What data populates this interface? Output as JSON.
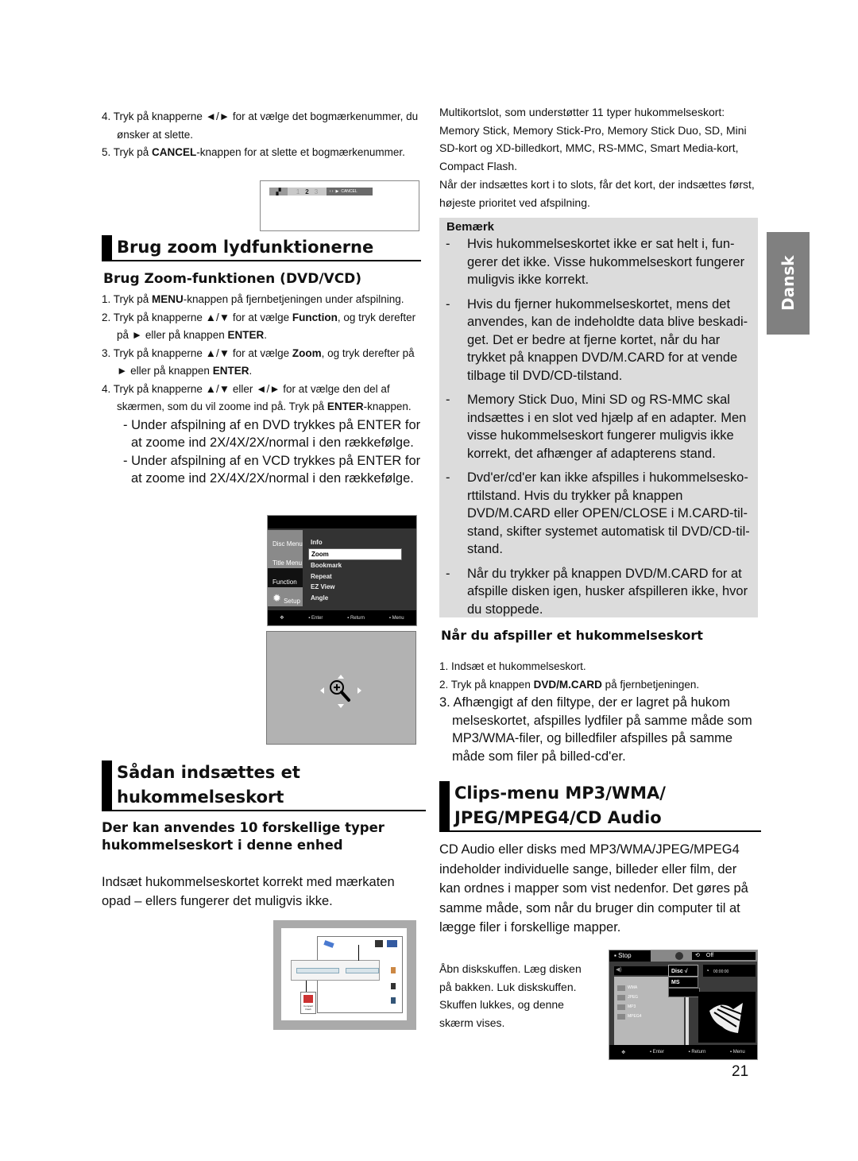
{
  "page_number": "21",
  "language_tab": "Dansk",
  "left": {
    "intro_steps": [
      {
        "num": "4.",
        "pre": "Tryk på knapperne ◄/► for at vælge det bogmærkenummer, du ønsker at slette."
      },
      {
        "num": "5.",
        "pre": "Tryk på ",
        "bold": "CANCEL",
        "post": "-knappen for at slette et bogmærkenummer."
      }
    ],
    "bookmark_osd": {
      "numbers": [
        "1",
        "2",
        "3"
      ],
      "cancel_label": "CANCEL"
    },
    "zoom_section": {
      "title": "Brug zoom lydfunktionerne",
      "subtitle": "Brug Zoom-funktionen (DVD/VCD)",
      "steps": [
        {
          "num": "1.",
          "a": "Tryk på ",
          "b": "MENU",
          "c": "-knappen på fjernbetjeningen under afspilning."
        },
        {
          "num": "2.",
          "a": "Tryk på knapperne ▲/▼ for at vælge ",
          "b": "Function",
          "c": ", og tryk derefter på ► eller på knappen ",
          "d": "ENTER",
          "e": "."
        },
        {
          "num": "3.",
          "a": "Tryk på knapperne ▲/▼ for at vælge ",
          "b": "Zoom",
          "c": ", og tryk derefter på ► eller på knappen ",
          "d": "ENTER",
          "e": "."
        },
        {
          "num": "4.",
          "a": "Tryk på knapperne ▲/▼ eller ◄/►  for at vælge den del af skærmen, som du vil zoome ind på. Tryk på ",
          "b": "ENTER",
          "c": "-knappen."
        }
      ],
      "sub_notes": [
        "Under afspilning af en DVD trykkes på ENTER for at zoome ind 2X/4X/2X/normal i den rækkefølge.",
        "Under afspilning af en VCD trykkes på ENTER for at zoome ind 2X/4X/2X/normal i den rækkefølge."
      ]
    },
    "function_menu": {
      "left_items": [
        "Disc Menu",
        "Title Menu",
        "Function",
        "Setup"
      ],
      "right_items": [
        "Info",
        "Zoom",
        "Bookmark",
        "Repeat",
        "EZ View",
        "Angle"
      ],
      "selected": "Zoom",
      "footer": [
        "Enter",
        "Return",
        "Menu"
      ]
    },
    "insert_section": {
      "title_line1": "Sådan indsættes et",
      "title_line2": "hukommelseskort",
      "subtitle": "Der kan anvendes 10 forskellige typer hukommelseskort i denne enhed",
      "body": "Indsæt hukommelseskortet korrekt med mærkaten opad – ellers fungerer det muligvis ikke.",
      "diagram_label": "Compact Flash"
    }
  },
  "right": {
    "intro_p1": "Multikortslot, som understøtter 11 typer hukommelseskort: Memory Stick, Memory Stick-Pro, Memory Stick Duo, SD, Mini SD-kort og XD-billedkort, MMC, RS-MMC, Smart Media-kort, Compact Flash.",
    "intro_p2": "Når der indsættes kort i to slots, får det kort, der indsættes først, højeste prioritet ved afspilning.",
    "note": {
      "title": "Bemærk",
      "items": [
        "Hvis hukommelseskortet ikke er sat helt i, fun-gerer det ikke. Visse hukommelseskort fungerer muligvis ikke korrekt.",
        "Hvis du fjerner hukommelseskortet, mens det anvendes, kan de indeholdte data blive beskadi-get. Det er bedre at fjerne kortet, når du har trykket på knappen DVD/M.CARD for at vende tilbage til DVD/CD-tilstand.",
        "Memory Stick Duo, Mini SD og RS-MMC skal indsættes i en slot ved hjælp af en adapter. Men visse hukommelseskort fungerer muligvis ikke korrekt, det afhænger af adapterens stand.",
        "Dvd'er/cd'er kan ikke afspilles i hukommelsesko-rttilstand. Hvis du trykker på knappen DVD/M.CARD eller OPEN/CLOSE i M.CARD-til-stand, skifter systemet automatisk til DVD/CD-til-stand.",
        "Når du trykker på knappen DVD/M.CARD for at afspille disken igen, husker afspilleren ikke, hvor du stoppede."
      ]
    },
    "play_section": {
      "title": "Når du afspiller et hukommelseskort",
      "step1": "Indsæt et hukommelseskort.",
      "step2_a": "Tryk på knappen ",
      "step2_b": "DVD/M.CARD",
      "step2_c": " på fjernbetjeningen.",
      "step3": "Afhængigt af den filtype, der er lagret på hukom melseskortet, afspilles lydfiler på samme måde som MP3/WMA-filer, og billedfiler afspilles på samme måde som filer på billed-cd'er."
    },
    "clips_section": {
      "title_line1": "Clips-menu MP3/WMA/",
      "title_line2": "JPEG/MPEG4/CD Audio",
      "body": "CD Audio eller disks med MP3/WMA/JPEG/MPEG4 indeholder individuelle sange, billeder eller film, der kan ordnes i mapper som vist nedenfor. Det gøres på samme måde, som når du bruger din computer til at lægge filer i forskellige mapper.",
      "caption": "Åbn diskskuffen. Læg disken på bakken. Luk diskskuffen. Skuffen lukkes, og denne skærm vises."
    },
    "clips_screen": {
      "status": "Stop",
      "repeat": "Off",
      "source_options": [
        "Disc",
        "MS"
      ],
      "source_check": "√",
      "time": "00:00:00",
      "folders": [
        "WMA",
        "JPEG",
        "MP3",
        "MPEG4"
      ],
      "footer": [
        "Enter",
        "Return",
        "Menu"
      ]
    }
  }
}
